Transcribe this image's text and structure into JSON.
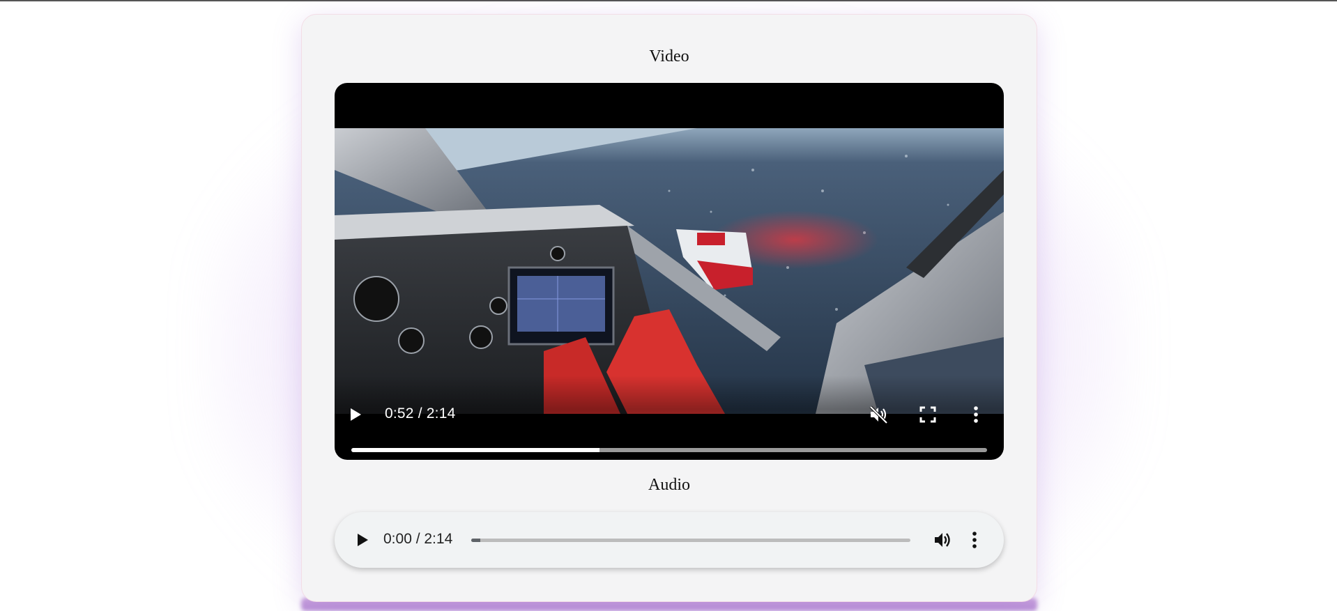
{
  "video_section": {
    "title": "Video",
    "player": {
      "current_time": "0:52",
      "duration": "2:14",
      "time_display": "0:52 / 2:14",
      "progress": 0.39,
      "muted": true,
      "scene_description_icon": "helicopter-cockpit-video-frame"
    }
  },
  "audio_section": {
    "title": "Audio",
    "player": {
      "current_time": "0:00",
      "duration": "2:14",
      "time_display": "0:00 / 2:14",
      "progress": 0.02,
      "muted": false
    }
  },
  "icons": {
    "play": "play-icon",
    "mute": "muted-speaker-icon",
    "volume": "speaker-icon",
    "fullscreen": "fullscreen-icon",
    "more": "more-options-icon"
  },
  "colors": {
    "card_bg": "#f4f4f5",
    "glow": "#c9a3dc",
    "video_progress_fill": "#ffffff",
    "audio_progress_fill": "#5f6368"
  }
}
